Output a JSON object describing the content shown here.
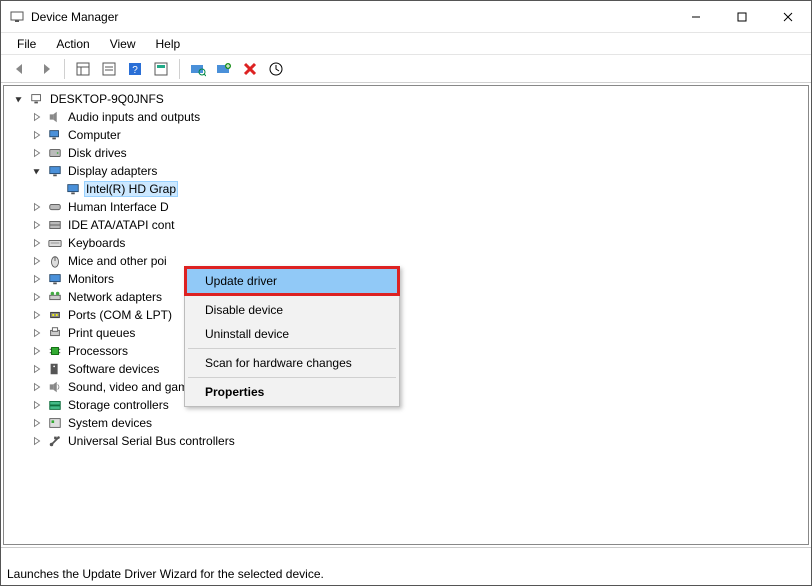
{
  "window": {
    "title": "Device Manager"
  },
  "menu": {
    "file": "File",
    "action": "Action",
    "view": "View",
    "help": "Help"
  },
  "tree": {
    "root": "DESKTOP-9Q0JNFS",
    "nodes": [
      {
        "label": "Audio inputs and outputs",
        "icon": "audio",
        "expanded": false
      },
      {
        "label": "Computer",
        "icon": "computer",
        "expanded": false
      },
      {
        "label": "Disk drives",
        "icon": "disk",
        "expanded": false
      },
      {
        "label": "Display adapters",
        "icon": "display",
        "expanded": true,
        "children": [
          {
            "label": "Intel(R) HD Grap",
            "icon": "display",
            "selected": true
          }
        ]
      },
      {
        "label": "Human Interface D",
        "icon": "hid",
        "expanded": false
      },
      {
        "label": "IDE ATA/ATAPI cont",
        "icon": "ide",
        "expanded": false
      },
      {
        "label": "Keyboards",
        "icon": "keyboard",
        "expanded": false
      },
      {
        "label": "Mice and other poi",
        "icon": "mouse",
        "expanded": false
      },
      {
        "label": "Monitors",
        "icon": "monitor",
        "expanded": false
      },
      {
        "label": "Network adapters",
        "icon": "network",
        "expanded": false
      },
      {
        "label": "Ports (COM & LPT)",
        "icon": "port",
        "expanded": false
      },
      {
        "label": "Print queues",
        "icon": "printer",
        "expanded": false
      },
      {
        "label": "Processors",
        "icon": "cpu",
        "expanded": false
      },
      {
        "label": "Software devices",
        "icon": "software",
        "expanded": false
      },
      {
        "label": "Sound, video and game controllers",
        "icon": "sound",
        "expanded": false
      },
      {
        "label": "Storage controllers",
        "icon": "storage",
        "expanded": false
      },
      {
        "label": "System devices",
        "icon": "system",
        "expanded": false
      },
      {
        "label": "Universal Serial Bus controllers",
        "icon": "usb",
        "expanded": false
      }
    ]
  },
  "context_menu": {
    "update": "Update driver",
    "disable": "Disable device",
    "uninstall": "Uninstall device",
    "scan": "Scan for hardware changes",
    "props": "Properties"
  },
  "status": "Launches the Update Driver Wizard for the selected device."
}
